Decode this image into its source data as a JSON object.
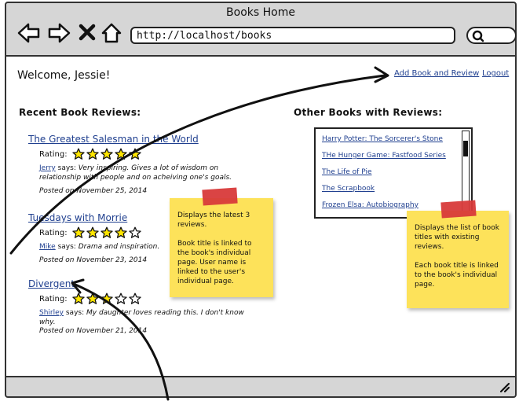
{
  "window": {
    "title": "Books Home",
    "url": "http://localhost/books"
  },
  "header": {
    "welcome": "Welcome, Jessie!",
    "add_book_link": "Add Book and Review",
    "logout_link": "Logout"
  },
  "recent_reviews": {
    "heading": "Recent Book Reviews:",
    "rating_label": "Rating:",
    "items": [
      {
        "title": "The Greatest Salesman in the World",
        "rating": 5,
        "user": "Jerry",
        "says": "says:",
        "comment": "Very inspiring. Gives a lot of wisdom on relationship with people and on acheiving one's goals.",
        "posted": "Posted on November 25, 2014"
      },
      {
        "title": "Tuesdays with Morrie",
        "rating": 4,
        "user": "Mike",
        "says": "says:",
        "comment": "Drama and inspiration.",
        "posted": "Posted on November 23, 2014"
      },
      {
        "title": "Divergent",
        "rating": 3,
        "user": "Shirley",
        "says": "says:",
        "comment": "My daughter loves reading this. I don't know why.",
        "posted": "Posted on November 21, 2014"
      }
    ]
  },
  "other_books": {
    "heading": "Other Books with Reviews:",
    "items": [
      "Harry Potter: The Sorcerer's Stone",
      "THe Hunger Game: Fastfood Series",
      "The Life of Pie",
      "The Scrapbook",
      "Frozen Elsa: Autobiography"
    ]
  },
  "notes": {
    "left": {
      "line1": "Displays the latest 3 reviews.",
      "line2": "Book title is linked to the book's individual page. User name is linked to the user's individual page."
    },
    "right": {
      "line1": "Displays the list of book titles with existing reviews.",
      "line2": "Each book title is linked to the book's individual page."
    }
  },
  "colors": {
    "link": "#1f3f8f",
    "sticky": "#fde25a",
    "tape": "#d83a3a",
    "star_fill": "#ffe600"
  }
}
